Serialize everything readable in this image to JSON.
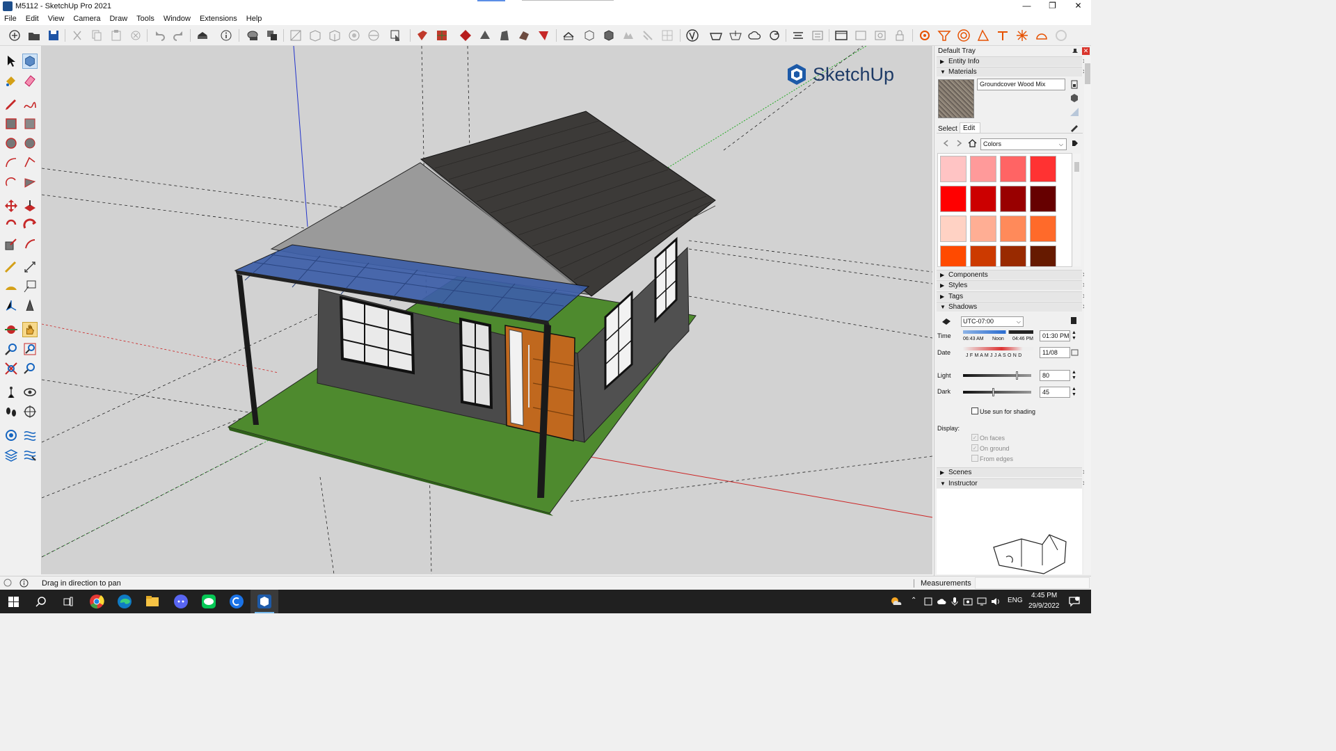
{
  "window": {
    "title": "M5112 - SketchUp Pro 2021",
    "minimize": "—",
    "maximize": "❐",
    "close": "✕"
  },
  "menu": [
    "File",
    "Edit",
    "View",
    "Camera",
    "Draw",
    "Tools",
    "Window",
    "Extensions",
    "Help"
  ],
  "viewport": {
    "logo_text": "SketchUp",
    "background": "#d2d2d2"
  },
  "status": {
    "message": "Drag in direction to pan",
    "measurements_label": "Measurements"
  },
  "tray": {
    "title": "Default Tray",
    "entity_info": "Entity Info",
    "materials": "Materials",
    "material_name": "Groundcover Wood Mix",
    "tab_select": "Select",
    "tab_edit": "Edit",
    "library": "Colors",
    "swatches": [
      "#ffc4c4",
      "#ff9a9a",
      "#ff6464",
      "#ff3232",
      "#ff0000",
      "#cc0000",
      "#990000",
      "#660000",
      "#ffd2c4",
      "#ffae94",
      "#ff8a5a",
      "#ff6a2a",
      "#ff4a00",
      "#cc3a00",
      "#992a00",
      "#661a00"
    ],
    "components": "Components",
    "styles": "Styles",
    "tags": "Tags",
    "shadows": "Shadows",
    "timezone": "UTC-07:00",
    "time_label": "Time",
    "time_start": "06:43 AM",
    "time_noon": "Noon",
    "time_end": "04:46 PM",
    "time_value": "01:30 PM",
    "date_label": "Date",
    "months": "J F M A M J J A S O N D",
    "date_value": "11/08",
    "light_label": "Light",
    "light_value": "80",
    "light_level": 0.8,
    "dark_label": "Dark",
    "dark_value": "45",
    "dark_level": 0.45,
    "use_sun": "Use sun for shading",
    "display_label": "Display:",
    "on_faces": "On faces",
    "on_ground": "On ground",
    "from_edges": "From edges",
    "scenes": "Scenes",
    "instructor": "Instructor"
  },
  "taskbar": {
    "lang": "ENG",
    "time": "4:45 PM",
    "date": "29/9/2022"
  }
}
